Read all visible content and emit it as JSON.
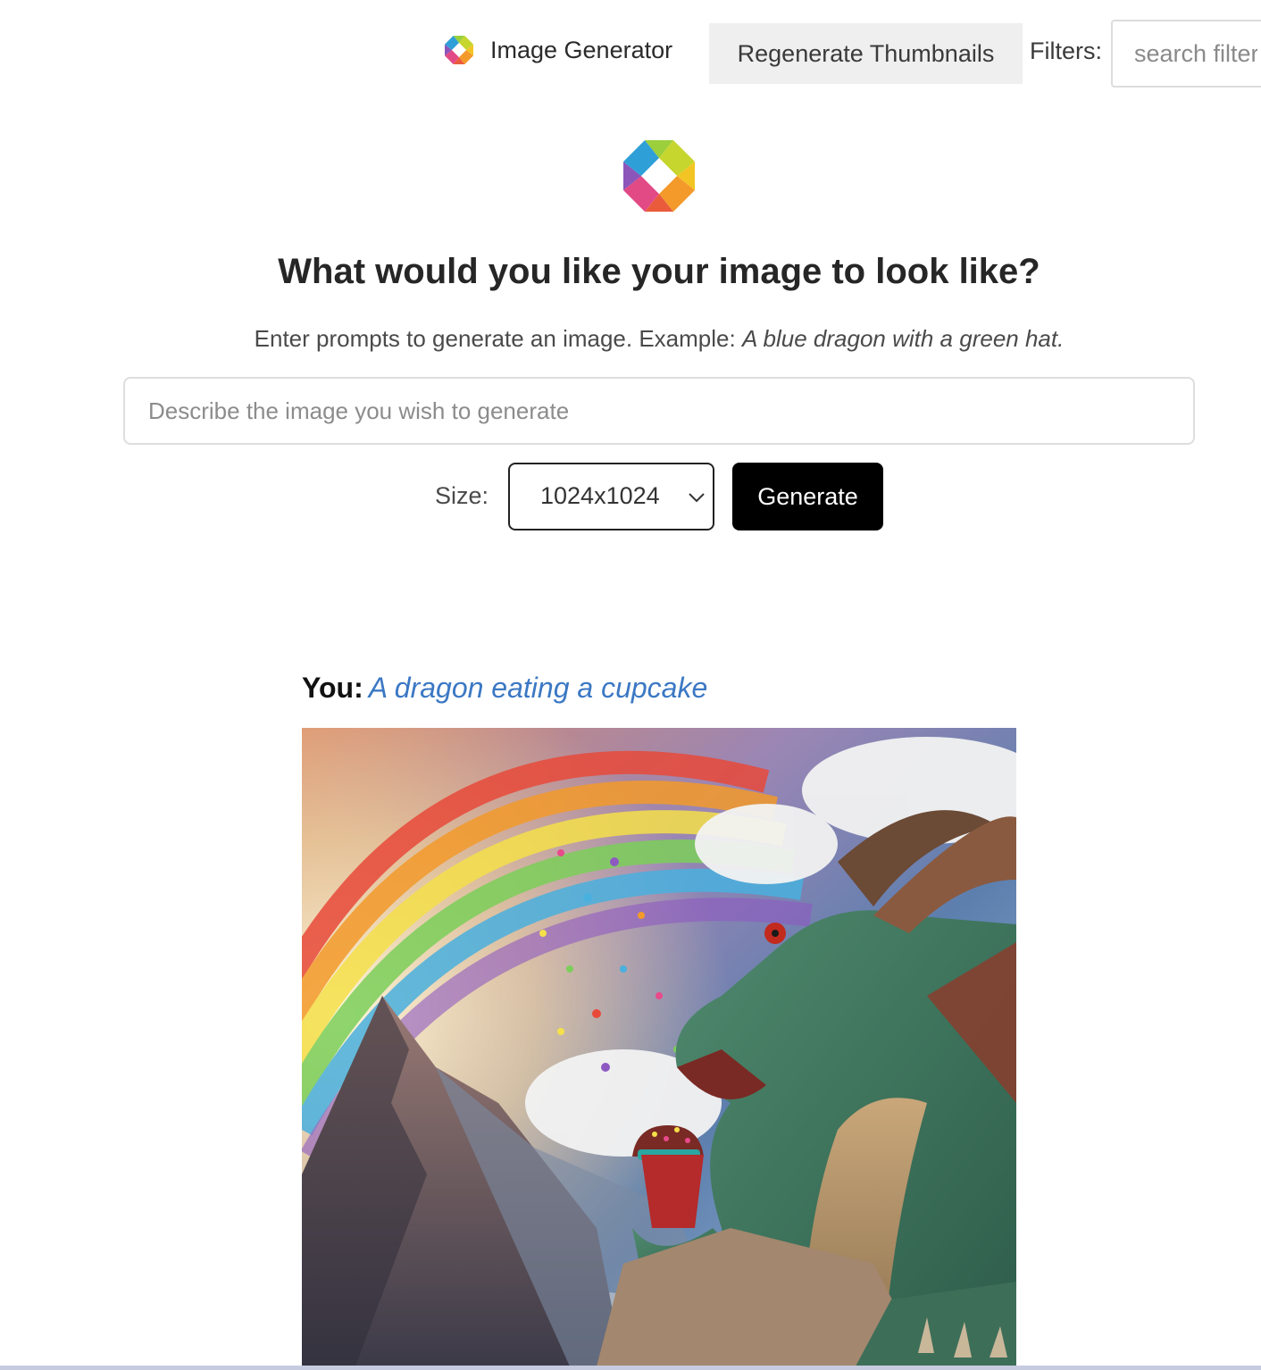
{
  "header": {
    "app_name": "Image Generator",
    "regenerate_label": "Regenerate Thumbnails",
    "filters_label": "Filters:",
    "filter_placeholder": "search filters"
  },
  "hero": {
    "title": "What would you like your image to look like?",
    "subtitle_prefix": "Enter prompts to generate an image. Example: ",
    "subtitle_example": "A blue dragon with a green hat."
  },
  "form": {
    "prompt_placeholder": "Describe the image you wish to generate",
    "prompt_value": "",
    "size_label": "Size:",
    "size_value": "1024x1024",
    "generate_label": "Generate"
  },
  "conversation": [
    {
      "speaker": "You:",
      "prompt": "A dragon eating a cupcake"
    }
  ],
  "colors": {
    "accent_link": "#3b78c4",
    "generate_button": "#000000",
    "regen_button": "#efefef"
  },
  "icons": {
    "logo": "colorful-octagon-logo-icon",
    "select_arrow": "chevron-down-icon"
  }
}
